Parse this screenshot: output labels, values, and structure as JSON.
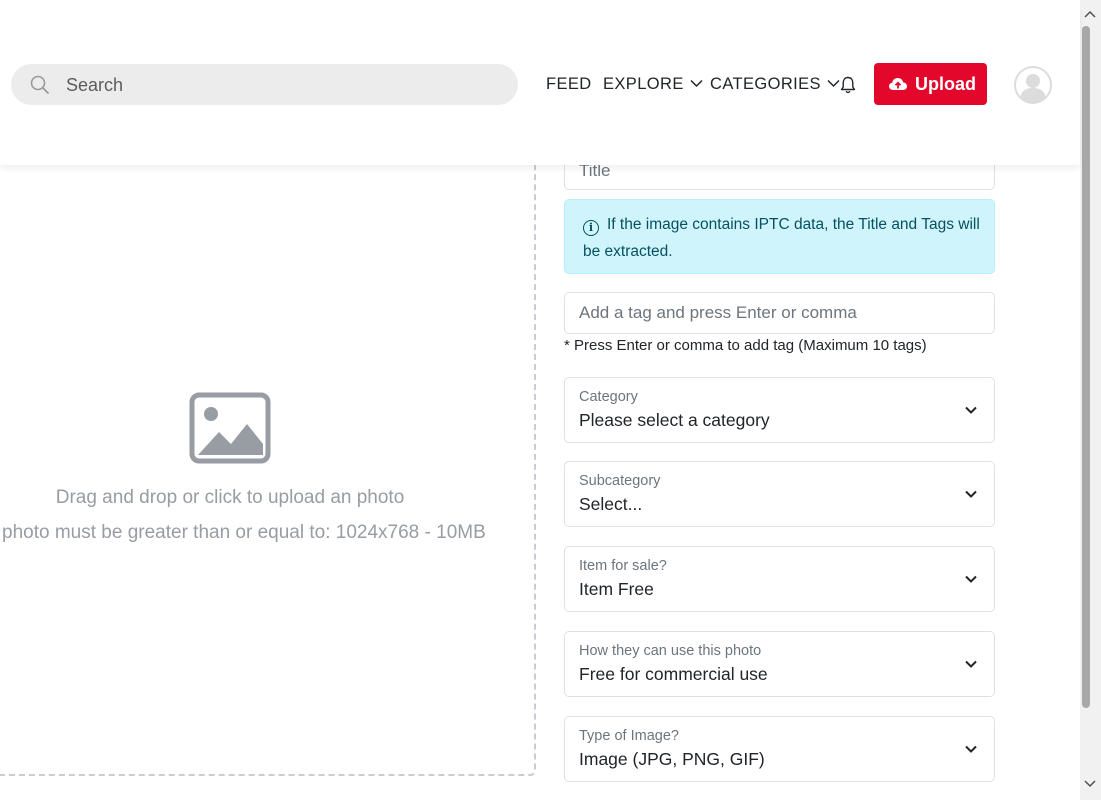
{
  "header": {
    "search_placeholder": "Search",
    "nav": {
      "feed": "FEED",
      "explore": "EXPLORE",
      "categories": "CATEGORIES"
    },
    "upload_label": "Upload"
  },
  "dropzone": {
    "text": "Drag and drop or click to upload an photo",
    "requirement": "photo must be greater than or equal to: 1024x768 - 10MB"
  },
  "form": {
    "title_placeholder": "Title",
    "iptc_alert": "If the image contains IPTC data, the Title and Tags will be extracted.",
    "tags_placeholder": "Add a tag and press Enter or comma",
    "tags_help": "* Press Enter or comma to add tag (Maximum 10 tags)",
    "selects": [
      {
        "label": "Category",
        "value": "Please select a category"
      },
      {
        "label": "Subcategory",
        "value": "Select..."
      },
      {
        "label": "Item for sale?",
        "value": "Item Free"
      },
      {
        "label": "How they can use this photo",
        "value": "Free for commercial use"
      },
      {
        "label": "Type of Image?",
        "value": "Image (JPG, PNG, GIF)"
      }
    ]
  },
  "colors": {
    "brand": "#e3072b",
    "alert_bg": "#cff4fc",
    "alert_text": "#055160"
  }
}
